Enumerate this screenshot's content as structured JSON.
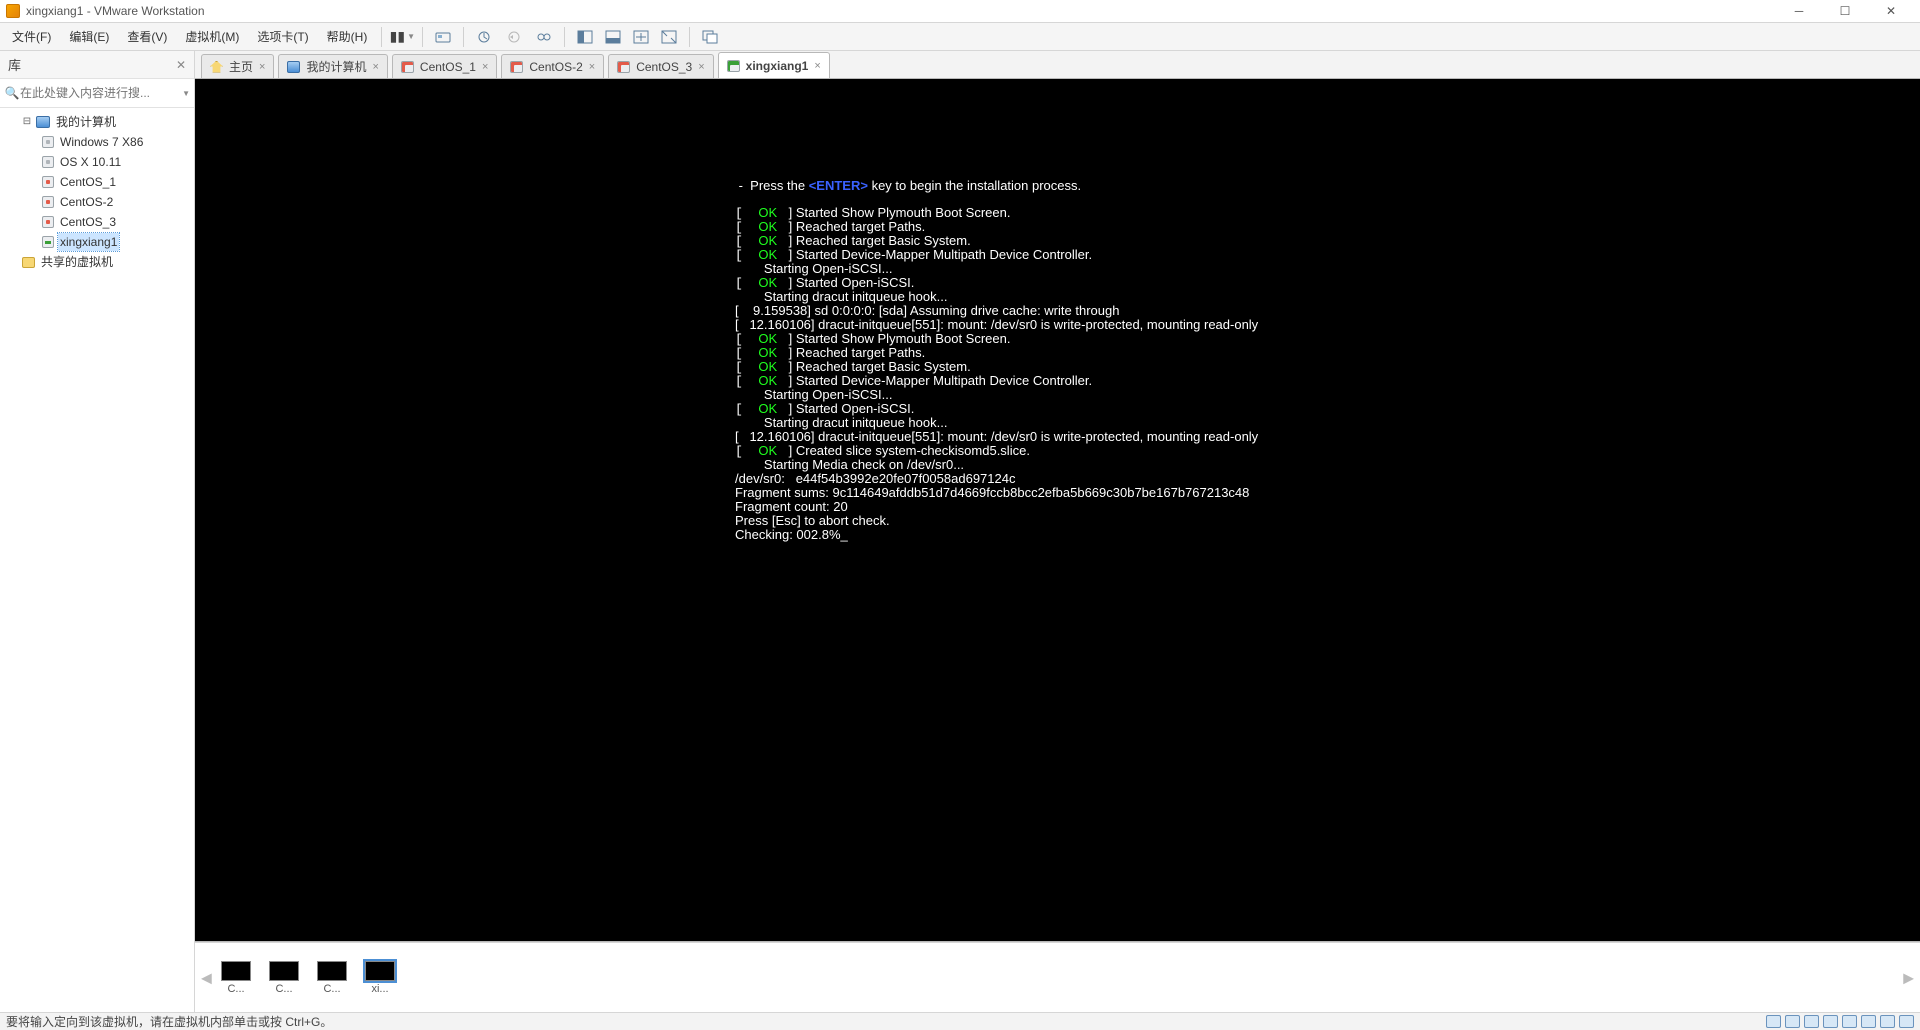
{
  "window": {
    "title": "xingxiang1 - VMware Workstation"
  },
  "menu": {
    "file": "文件(F)",
    "edit": "编辑(E)",
    "view": "查看(V)",
    "vm": "虚拟机(M)",
    "tabs": "选项卡(T)",
    "help": "帮助(H)"
  },
  "library": {
    "title": "库",
    "search_placeholder": "在此处键入内容进行搜...",
    "root": "我的计算机",
    "items": [
      {
        "label": "Windows 7 X86",
        "state": "no"
      },
      {
        "label": "OS X 10.11",
        "state": "no"
      },
      {
        "label": "CentOS_1",
        "state": "red"
      },
      {
        "label": "CentOS-2",
        "state": "red"
      },
      {
        "label": "CentOS_3",
        "state": "red"
      },
      {
        "label": "xingxiang1",
        "state": "on"
      }
    ],
    "shared": "共享的虚拟机"
  },
  "tabs": [
    {
      "label": "主页",
      "icon": "home"
    },
    {
      "label": "我的计算机",
      "icon": "pc"
    },
    {
      "label": "CentOS_1",
      "icon": "red"
    },
    {
      "label": "CentOS-2",
      "icon": "red"
    },
    {
      "label": "CentOS_3",
      "icon": "red"
    },
    {
      "label": "xingxiang1",
      "icon": "on",
      "active": true
    }
  ],
  "thumbs": [
    {
      "label": "C..."
    },
    {
      "label": "C..."
    },
    {
      "label": "C..."
    },
    {
      "label": "xi...",
      "sel": true
    }
  ],
  "status": {
    "hint": "要将输入定向到该虚拟机，请在虚拟机内部单击或按 Ctrl+G。"
  },
  "console": {
    "l0a": " -  Press the ",
    "l0b": "<ENTER>",
    "l0c": " key to begin the installation process.",
    "ok": "OK",
    "l1": " ] Started Show Plymouth Boot Screen.",
    "l2": " ] Reached target Paths.",
    "l3": " ] Reached target Basic System.",
    "l4": " ] Started Device-Mapper Multipath Device Controller.",
    "l5": "        Starting Open-iSCSI...",
    "l6": " ] Started Open-iSCSI.",
    "l7": "        Starting dracut initqueue hook...",
    "t1": "[    9.159538] sd 0:0:0:0: [sda] Assuming drive cache: write through",
    "t2": "[   12.160106] dracut-initqueue[551]: mount: /dev/sr0 is write-protected, mounting read-only",
    "l8": " ] Created slice system-checkisomd5.slice.",
    "l9": "        Starting Media check on /dev/sr0...",
    "l10": "/dev/sr0:   e44f54b3992e20fe07f0058ad697124c",
    "l11": "Fragment sums: 9c114649afddb51d7d4669fccb8bcc2efba5b669c30b7be167b767213c48",
    "l12": "Fragment count: 20",
    "l13": "Press [Esc] to abort check.",
    "l14": "Checking: 002.8%"
  }
}
